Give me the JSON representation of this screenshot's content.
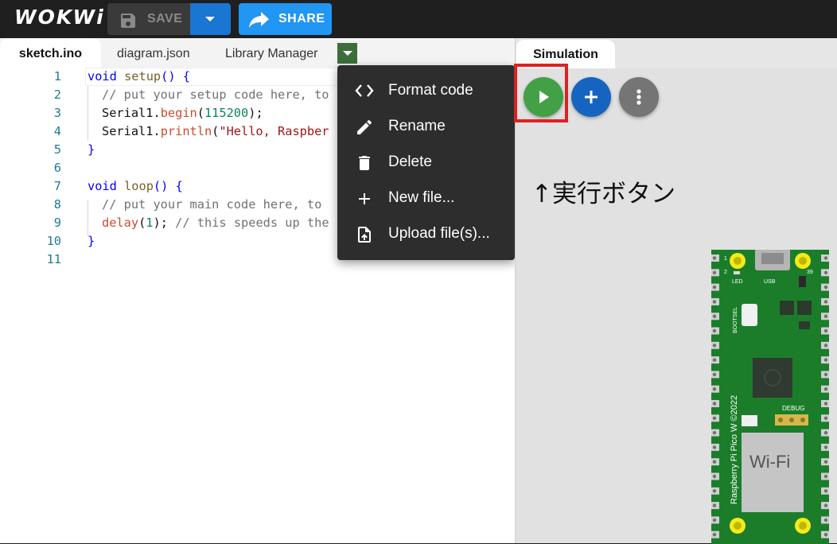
{
  "header": {
    "logo_text": "WOKWi",
    "save_label": "SAVE",
    "share_label": "SHARE"
  },
  "editor": {
    "tabs": [
      {
        "label": "sketch.ino",
        "active": true
      },
      {
        "label": "diagram.json",
        "active": false
      },
      {
        "label": "Library Manager",
        "active": false
      }
    ],
    "line_numbers": [
      "1",
      "2",
      "3",
      "4",
      "5",
      "6",
      "7",
      "8",
      "9",
      "10",
      "11"
    ],
    "code": {
      "l1_kw": "void",
      "l1_fn": "setup",
      "l1_rest": "() {",
      "l2": "// put your setup code here, to",
      "l3_obj": "Serial1.",
      "l3_fn": "begin",
      "l3_open": "(",
      "l3_num": "115200",
      "l3_close": ");",
      "l4_obj": "Serial1.",
      "l4_fn": "println",
      "l4_open": "(",
      "l4_str": "\"Hello, Raspber",
      "l5": "}",
      "l7_kw": "void",
      "l7_fn": "loop",
      "l7_rest": "() {",
      "l8": "// put your main code here, to",
      "l9_fn": "delay",
      "l9_open": "(",
      "l9_num": "1",
      "l9_close": ");",
      "l9_cm": "// this speeds up the",
      "l10": "}"
    }
  },
  "context_menu": {
    "items": [
      {
        "label": "Format code",
        "icon": "code-brackets-icon"
      },
      {
        "label": "Rename",
        "icon": "pencil-icon"
      },
      {
        "label": "Delete",
        "icon": "trash-icon"
      },
      {
        "label": "New file...",
        "icon": "plus-icon"
      },
      {
        "label": "Upload file(s)...",
        "icon": "upload-file-icon"
      }
    ]
  },
  "simulation": {
    "tab_label": "Simulation",
    "annotation": "↑実行ボタン",
    "board": {
      "led_label": "LED",
      "usb_label": "USB",
      "bootsel_label": "BOOTSEL",
      "debug_label": "DEBUG",
      "wifi_label": "Wi-Fi",
      "board_text": "Raspberry Pi Pico W ©2022",
      "pin_1": "1",
      "pin_2": "2",
      "pin_39": "39"
    }
  },
  "colors": {
    "play_green": "#43a047",
    "add_blue": "#1565c0",
    "more_gray": "#757575",
    "highlight_red": "#e02020",
    "board_green": "#1b7d2a"
  }
}
